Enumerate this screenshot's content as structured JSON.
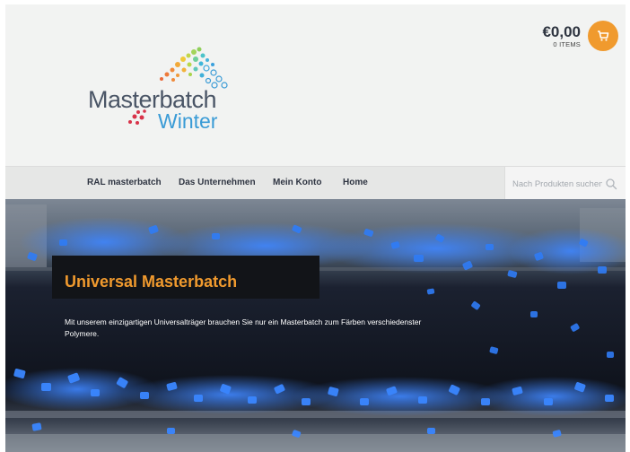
{
  "header": {
    "logo": {
      "word1": "Masterbatch",
      "word2": "Winter"
    },
    "cart": {
      "amount": "€0,00",
      "items": "0 ITEMS",
      "icon": "shopping-cart-icon",
      "accent": "#f09a2e"
    }
  },
  "nav": {
    "items": [
      {
        "label": "RAL masterbatch"
      },
      {
        "label": "Das Unternehmen"
      },
      {
        "label": "Mein Konto"
      },
      {
        "label": "Home"
      }
    ],
    "search": {
      "placeholder": "Nach Produkten suchen",
      "icon": "search-icon"
    }
  },
  "hero": {
    "title": "Universal Masterbatch",
    "description": "Mit unserem einzigartigen Universalträger brauchen Sie nur ein Masterbatch zum Färben verschiedenster Polymere.",
    "title_color": "#f09a2e"
  }
}
